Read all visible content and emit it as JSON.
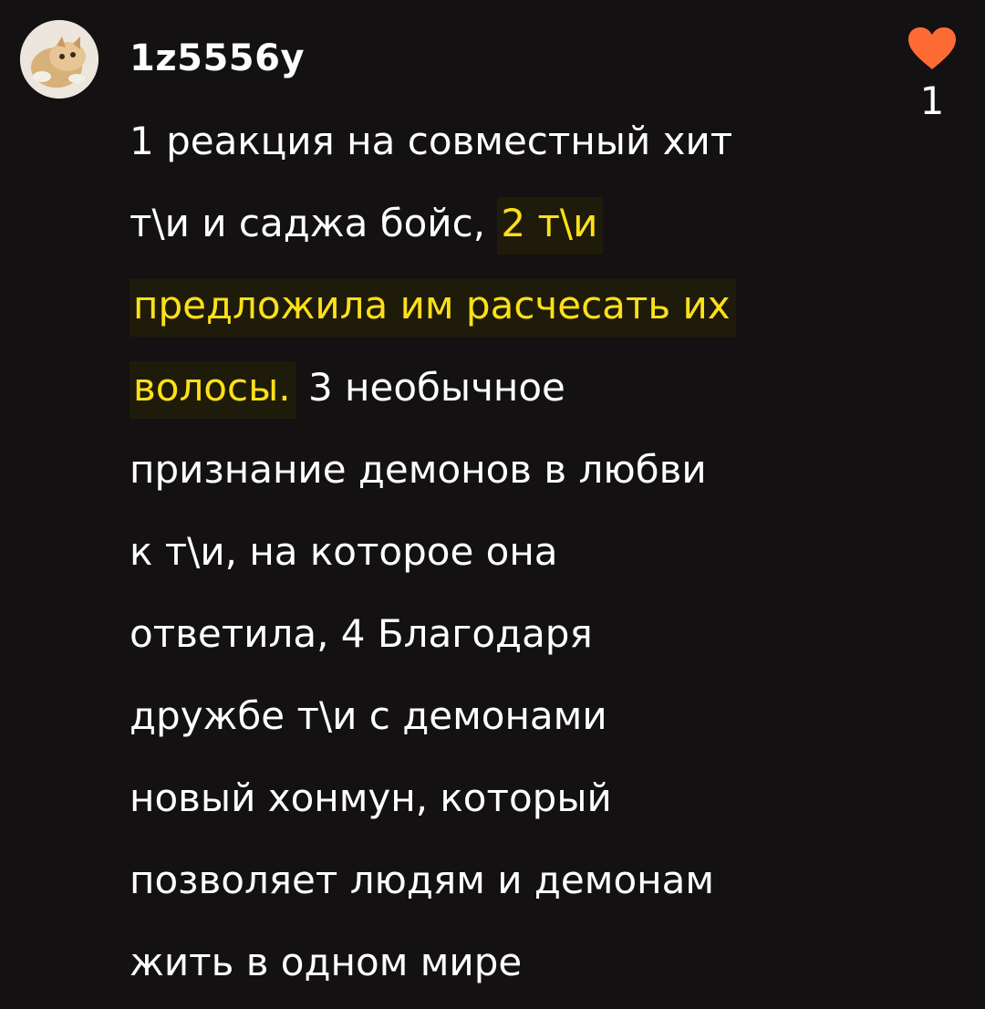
{
  "comment": {
    "username": "1z5556y",
    "likes": "1",
    "heart_color": "#ff6b35",
    "highlight_color": "#fde018",
    "lines": {
      "l1": "1 реакция на совместный  хит",
      "l2a": "т\\и и саджа бойс, ",
      "l2b": "2 т\\и",
      "l3": "предложила им расчесать их",
      "l4a": "волосы.",
      "l4b": " 3 необычное",
      "l5": "признание демонов в любви",
      "l6": "к т\\и, на которое она",
      "l7": "ответила, 4 Благодаря",
      "l8": "дружбе т\\и  с демонами",
      "l9": "новый хонмун, который",
      "l10": "позволяет людям и демонам",
      "l11": "жить в одном мире"
    }
  },
  "icons": {
    "avatar": "avatar-image",
    "like": "heart-icon"
  }
}
